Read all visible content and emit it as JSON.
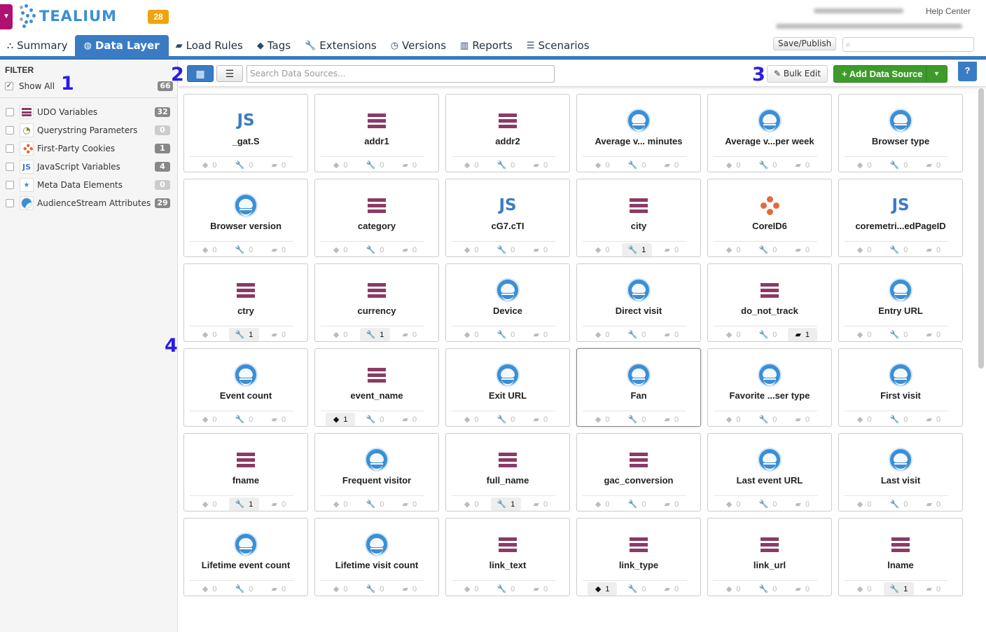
{
  "header": {
    "brand": "TEALIUM",
    "notification_count": "28",
    "help_center": "Help Center",
    "save_publish": "Save/Publish"
  },
  "tabs": [
    {
      "label": "Summary",
      "icon": "sitemap-icon"
    },
    {
      "label": "Data Layer",
      "icon": "globe-icon",
      "active": true
    },
    {
      "label": "Load Rules",
      "icon": "book-icon"
    },
    {
      "label": "Tags",
      "icon": "tag-icon"
    },
    {
      "label": "Extensions",
      "icon": "wrench-icon"
    },
    {
      "label": "Versions",
      "icon": "clock-icon"
    },
    {
      "label": "Reports",
      "icon": "bar-chart-icon"
    },
    {
      "label": "Scenarios",
      "icon": "list-icon"
    }
  ],
  "sidebar": {
    "heading": "FILTER",
    "show_all": {
      "label": "Show All",
      "count": "66",
      "checked": true
    },
    "items": [
      {
        "label": "UDO Variables",
        "count": "32",
        "type": "udo"
      },
      {
        "label": "Querystring Parameters",
        "count": "0",
        "type": "qs"
      },
      {
        "label": "First-Party Cookies",
        "count": "1",
        "type": "cookie"
      },
      {
        "label": "JavaScript Variables",
        "count": "4",
        "type": "js"
      },
      {
        "label": "Meta Data Elements",
        "count": "0",
        "type": "meta"
      },
      {
        "label": "AudienceStream Attributes",
        "count": "29",
        "type": "as"
      }
    ]
  },
  "annotations": [
    "1",
    "2",
    "3",
    "4"
  ],
  "toolbar": {
    "search_placeholder": "Search Data Sources...",
    "bulk_edit": "Bulk Edit",
    "add_data_source": "+ Add Data Source",
    "help": "?"
  },
  "colors": {
    "primary": "#3a7cc4",
    "udo": "#8b3a65",
    "cookie": "#e26a3f",
    "add": "#3d9b2a",
    "badge": "#f0a30a"
  },
  "cards": [
    {
      "name": "_gat.S",
      "type": "js",
      "tags": "0",
      "ext": "0",
      "rules": "0"
    },
    {
      "name": "addr1",
      "type": "udo",
      "tags": "0",
      "ext": "0",
      "rules": "0"
    },
    {
      "name": "addr2",
      "type": "udo",
      "tags": "0",
      "ext": "0",
      "rules": "0"
    },
    {
      "name": "Average v... minutes",
      "type": "as",
      "tags": "0",
      "ext": "0",
      "rules": "0"
    },
    {
      "name": "Average v...per week",
      "type": "as",
      "tags": "0",
      "ext": "0",
      "rules": "0"
    },
    {
      "name": "Browser type",
      "type": "as",
      "tags": "0",
      "ext": "0",
      "rules": "0"
    },
    {
      "name": "Browser version",
      "type": "as",
      "tags": "0",
      "ext": "0",
      "rules": "0"
    },
    {
      "name": "category",
      "type": "udo",
      "tags": "0",
      "ext": "0",
      "rules": "0"
    },
    {
      "name": "cG7.cTI",
      "type": "js",
      "tags": "0",
      "ext": "0",
      "rules": "0"
    },
    {
      "name": "city",
      "type": "udo",
      "tags": "0",
      "ext": "1",
      "rules": "0"
    },
    {
      "name": "CoreID6",
      "type": "cookie",
      "tags": "0",
      "ext": "0",
      "rules": "0"
    },
    {
      "name": "coremetri...edPageID",
      "type": "js",
      "tags": "0",
      "ext": "0",
      "rules": "0"
    },
    {
      "name": "ctry",
      "type": "udo",
      "tags": "0",
      "ext": "1",
      "rules": "0"
    },
    {
      "name": "currency",
      "type": "udo",
      "tags": "0",
      "ext": "1",
      "rules": "0"
    },
    {
      "name": "Device",
      "type": "as",
      "tags": "0",
      "ext": "0",
      "rules": "0"
    },
    {
      "name": "Direct visit",
      "type": "as",
      "tags": "0",
      "ext": "0",
      "rules": "0"
    },
    {
      "name": "do_not_track",
      "type": "udo",
      "tags": "0",
      "ext": "0",
      "rules": "1"
    },
    {
      "name": "Entry URL",
      "type": "as",
      "tags": "0",
      "ext": "0",
      "rules": "0"
    },
    {
      "name": "Event count",
      "type": "as",
      "tags": "0",
      "ext": "0",
      "rules": "0"
    },
    {
      "name": "event_name",
      "type": "udo",
      "tags": "1",
      "ext": "0",
      "rules": "0"
    },
    {
      "name": "Exit URL",
      "type": "as",
      "tags": "0",
      "ext": "0",
      "rules": "0"
    },
    {
      "name": "Fan",
      "type": "as",
      "tags": "0",
      "ext": "0",
      "rules": "0",
      "selected": true
    },
    {
      "name": "Favorite ...ser type",
      "type": "as",
      "tags": "0",
      "ext": "0",
      "rules": "0"
    },
    {
      "name": "First visit",
      "type": "as",
      "tags": "0",
      "ext": "0",
      "rules": "0"
    },
    {
      "name": "fname",
      "type": "udo",
      "tags": "0",
      "ext": "1",
      "rules": "0"
    },
    {
      "name": "Frequent visitor",
      "type": "as",
      "tags": "0",
      "ext": "0",
      "rules": "0"
    },
    {
      "name": "full_name",
      "type": "udo",
      "tags": "0",
      "ext": "1",
      "rules": "0"
    },
    {
      "name": "gac_conversion",
      "type": "udo",
      "tags": "0",
      "ext": "0",
      "rules": "0"
    },
    {
      "name": "Last event URL",
      "type": "as",
      "tags": "0",
      "ext": "0",
      "rules": "0"
    },
    {
      "name": "Last visit",
      "type": "as",
      "tags": "0",
      "ext": "0",
      "rules": "0"
    },
    {
      "name": "Lifetime event count",
      "type": "as",
      "tags": "0",
      "ext": "0",
      "rules": "0"
    },
    {
      "name": "Lifetime visit count",
      "type": "as",
      "tags": "0",
      "ext": "0",
      "rules": "0"
    },
    {
      "name": "link_text",
      "type": "udo",
      "tags": "0",
      "ext": "0",
      "rules": "0"
    },
    {
      "name": "link_type",
      "type": "udo",
      "tags": "1",
      "ext": "0",
      "rules": "0"
    },
    {
      "name": "link_url",
      "type": "udo",
      "tags": "0",
      "ext": "0",
      "rules": "0"
    },
    {
      "name": "lname",
      "type": "udo",
      "tags": "0",
      "ext": "1",
      "rules": "0"
    }
  ]
}
